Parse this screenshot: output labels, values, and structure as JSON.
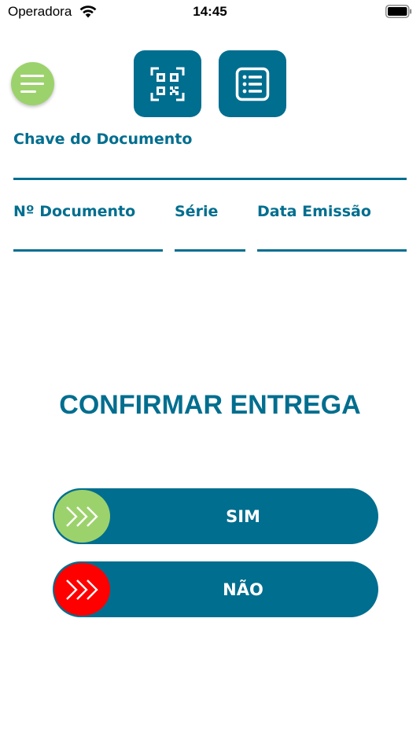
{
  "status_bar": {
    "carrier": "Operadora",
    "time": "14:45"
  },
  "form": {
    "chave_label": "Chave do Documento",
    "numero_label": "Nº Documento",
    "serie_label": "Série",
    "data_label": "Data Emissão"
  },
  "confirm": {
    "title": "CONFIRMAR ENTREGA",
    "sim_label": "SIM",
    "nao_label": "NÃO"
  },
  "colors": {
    "primary": "#006e8f",
    "accent_green": "#9cd26c",
    "accent_red": "#ff0000"
  },
  "icons": {
    "menu": "hamburger-icon",
    "qr": "qr-code-icon",
    "list": "list-icon",
    "chevrons": "triple-chevron-right-icon"
  }
}
